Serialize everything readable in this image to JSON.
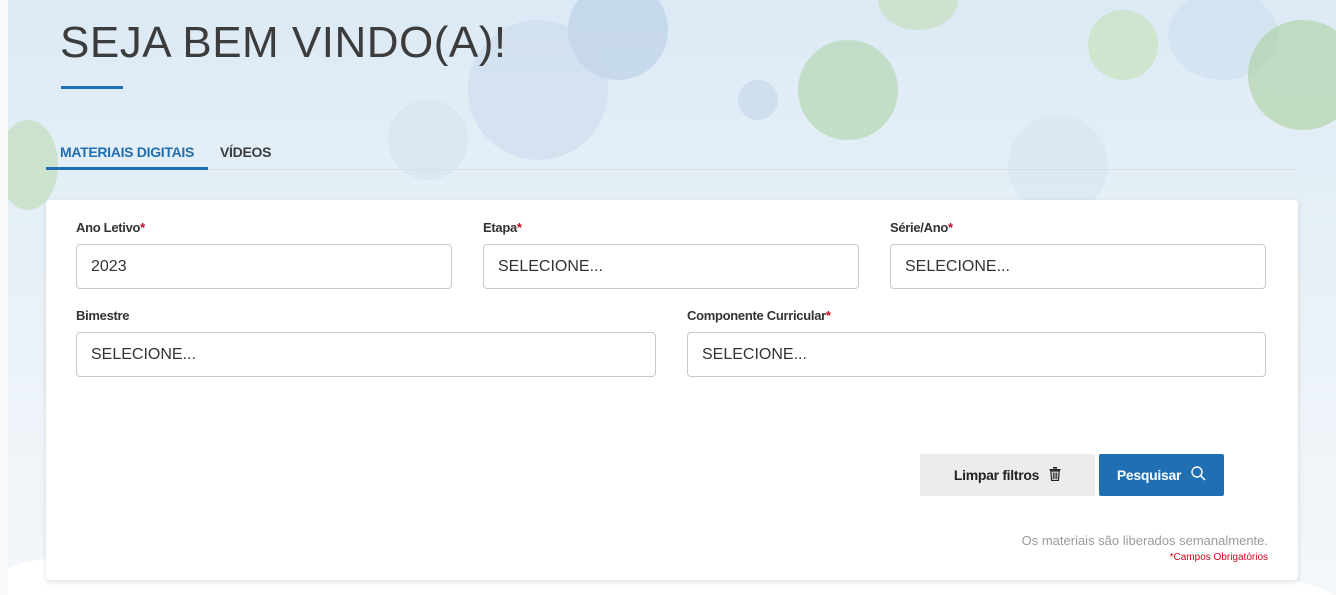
{
  "header": {
    "title": "SEJA BEM VINDO(A)!"
  },
  "tabs": [
    {
      "label": "MATERIAIS DIGITAIS",
      "active": true
    },
    {
      "label": "VÍDEOS",
      "active": false
    }
  ],
  "form": {
    "required_marker": "*",
    "fields": {
      "ano_letivo": {
        "label": "Ano Letivo",
        "required": true,
        "value": "2023"
      },
      "etapa": {
        "label": "Etapa",
        "required": true,
        "value": "SELECIONE..."
      },
      "serie_ano": {
        "label": "Série/Ano",
        "required": true,
        "value": "SELECIONE..."
      },
      "bimestre": {
        "label": "Bimestre",
        "required": false,
        "value": "SELECIONE..."
      },
      "componente": {
        "label": "Componente Curricular",
        "required": true,
        "value": "SELECIONE..."
      }
    },
    "buttons": {
      "clear_label": "Limpar filtros",
      "search_label": "Pesquisar"
    },
    "notes": {
      "weekly": "Os materiais são liberados semanalmente.",
      "required": "*Campos Obrigatórios"
    }
  },
  "colors": {
    "accent": "#1f6fb2",
    "required": "#d0021b"
  }
}
